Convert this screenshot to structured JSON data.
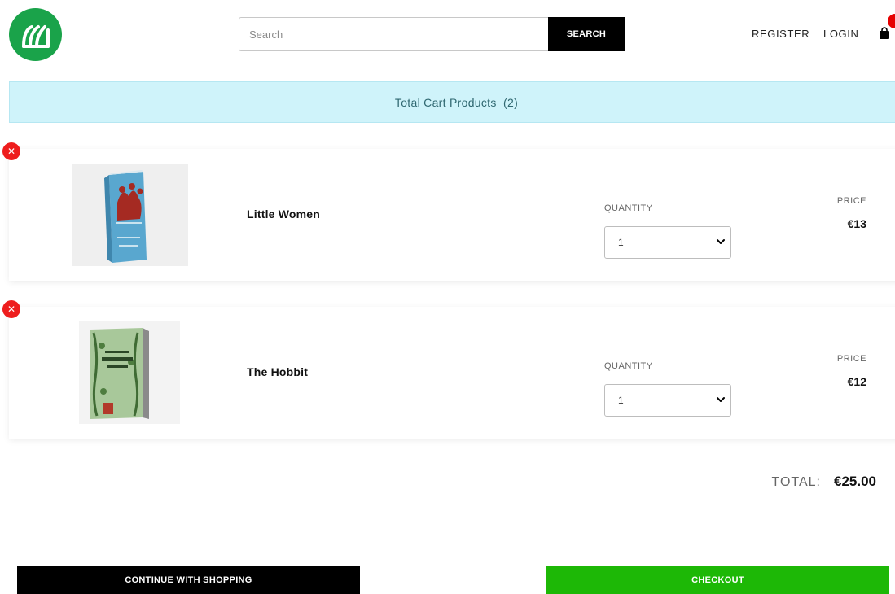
{
  "header": {
    "search_placeholder": "Search",
    "search_button": "SEARCH",
    "register": "REGISTER",
    "login": "LOGIN",
    "cart_icon": "shopping-bag-icon",
    "logo_icon": "brand-logo-icon"
  },
  "banner": {
    "text": "Total Cart Products  (2)"
  },
  "cart": {
    "items": [
      {
        "name": "Little Women",
        "quantity_label": "QUANTITY",
        "quantity": "1",
        "price_label": "PRICE",
        "price": "€13"
      },
      {
        "name": "The Hobbit",
        "quantity_label": "QUANTITY",
        "quantity": "1",
        "price_label": "PRICE",
        "price": "€12"
      }
    ],
    "total_label": "TOTAL:",
    "total_value": "€25.00"
  },
  "actions": {
    "continue": "CONTINUE WITH SHOPPING",
    "checkout": "CHECKOUT"
  },
  "colors": {
    "brand_green": "#1aa34a",
    "checkout_green": "#1db806",
    "banner_bg": "#cff3fa",
    "remove_red": "#ee1d1d"
  }
}
